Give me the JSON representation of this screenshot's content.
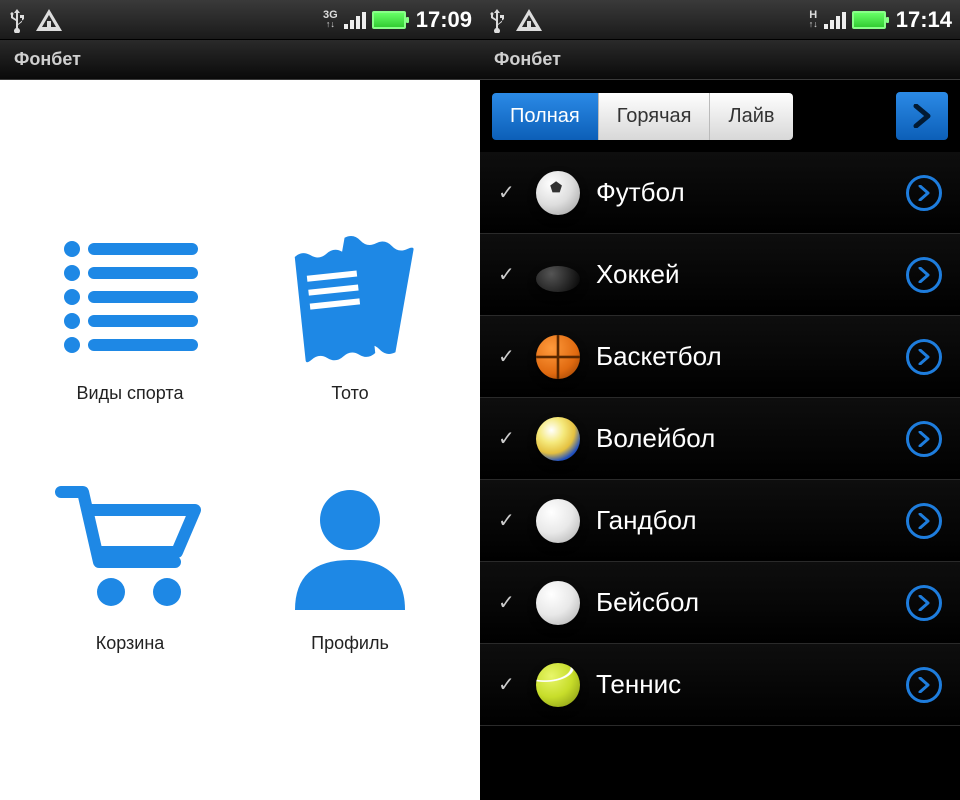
{
  "left": {
    "statusbar": {
      "net_label": "3G",
      "time": "17:09"
    },
    "app_title": "Фонбет",
    "grid": [
      {
        "id": "sports-types",
        "label": "Виды спорта",
        "icon": "list-icon"
      },
      {
        "id": "toto",
        "label": "Тото",
        "icon": "tickets-icon"
      },
      {
        "id": "cart",
        "label": "Корзина",
        "icon": "cart-icon"
      },
      {
        "id": "profile",
        "label": "Профиль",
        "icon": "profile-icon"
      }
    ]
  },
  "right": {
    "statusbar": {
      "net_label": "H",
      "time": "17:14"
    },
    "app_title": "Фонбет",
    "tabs": {
      "items": [
        {
          "id": "full",
          "label": "Полная",
          "active": true
        },
        {
          "id": "hot",
          "label": "Горячая",
          "active": false
        },
        {
          "id": "live",
          "label": "Лайв",
          "active": false
        }
      ]
    },
    "sports": [
      {
        "id": "football",
        "label": "Футбол",
        "ball": "ball-football",
        "checked": true
      },
      {
        "id": "hockey",
        "label": "Хоккей",
        "ball": "ball-hockey",
        "checked": true
      },
      {
        "id": "basketball",
        "label": "Баскетбол",
        "ball": "ball-basketball",
        "checked": true
      },
      {
        "id": "volleyball",
        "label": "Волейбол",
        "ball": "ball-volleyball",
        "checked": true
      },
      {
        "id": "handball",
        "label": "Гандбол",
        "ball": "ball-white",
        "checked": true
      },
      {
        "id": "baseball",
        "label": "Бейсбол",
        "ball": "ball-white",
        "checked": true
      },
      {
        "id": "tennis",
        "label": "Теннис",
        "ball": "ball-tennis",
        "checked": true
      }
    ]
  },
  "colors": {
    "accent": "#1e7ddd"
  }
}
